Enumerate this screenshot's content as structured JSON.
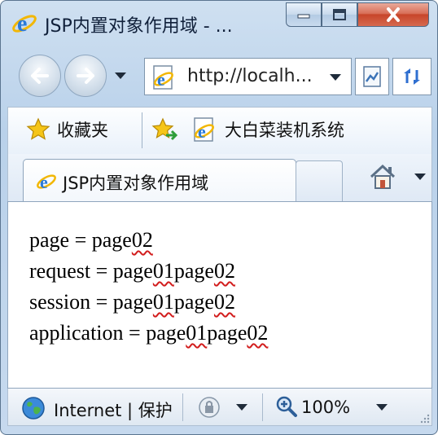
{
  "window": {
    "title": "JSP内置对象作用域 - ...",
    "caption_buttons": {
      "minimize": "minimize-icon",
      "maximize": "maximize-icon",
      "close": "close-icon"
    }
  },
  "address_bar": {
    "url": "http://localh...",
    "icons": [
      "back-arrow-icon",
      "forward-arrow-icon",
      "ie-logo-icon",
      "compatibility-view-icon",
      "refresh-icon"
    ]
  },
  "favorites_bar": {
    "favorites_label": "收藏夹",
    "link_label": "大白菜装机系统"
  },
  "tabs": [
    {
      "label": "JSP内置对象作用域"
    }
  ],
  "content": {
    "lines": [
      {
        "name": "page",
        "prefix": "page = ",
        "segments": [
          "page",
          "02"
        ]
      },
      {
        "name": "request",
        "prefix": "request = ",
        "segments": [
          "page",
          "01",
          "page",
          "02"
        ]
      },
      {
        "name": "session",
        "prefix": "session = ",
        "segments": [
          "page",
          "01",
          "page",
          "02"
        ]
      },
      {
        "name": "application",
        "prefix": "application = ",
        "segments": [
          "page",
          "01",
          "page",
          "02"
        ]
      }
    ]
  },
  "status_bar": {
    "zone_text": "Internet | 保护",
    "zoom": "100%"
  },
  "colors": {
    "frame": "#b9d1ea",
    "close_button": "#c7452a",
    "spellcheck_underline": "#d21d1d"
  }
}
